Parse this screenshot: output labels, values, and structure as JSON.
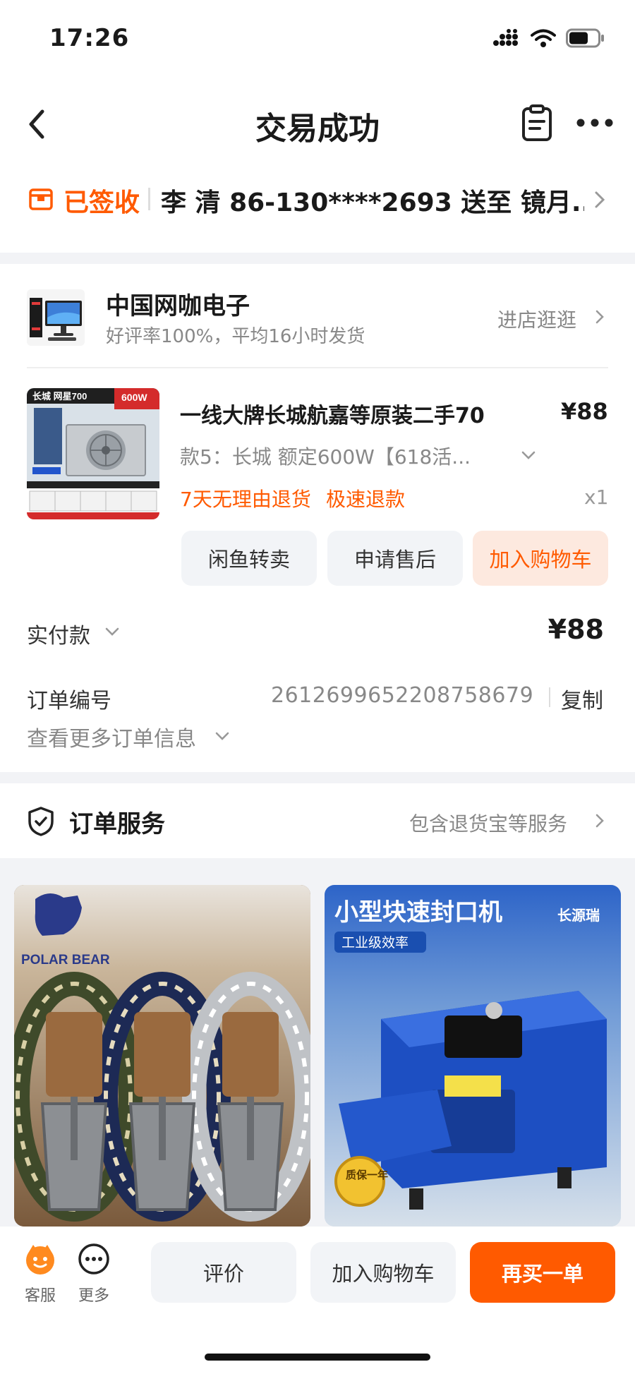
{
  "status_bar": {
    "time": "17:26"
  },
  "nav": {
    "title": "交易成功"
  },
  "delivery": {
    "status": "已签收",
    "recipient_line": "李 清 86-130****2693 送至 镜月..."
  },
  "shop": {
    "name": "中国网咖电子",
    "subtitle": "好评率100%，平均16小时发货",
    "link": "进店逛逛"
  },
  "product": {
    "title": "一线大牌长城航嘉等原装二手70",
    "price": "¥88",
    "spec": "款5：长城 额定600W【618活...",
    "tag_return": "7天无理由退货",
    "tag_refund": "极速退款",
    "quantity": "x1",
    "image_text": {
      "brand": "长城 网星700",
      "wattage": "600W"
    }
  },
  "actions": {
    "resell": "闲鱼转卖",
    "after_sale": "申请售后",
    "add_cart": "加入购物车"
  },
  "payment": {
    "label": "实付款",
    "amount": "¥88"
  },
  "order": {
    "label": "订单编号",
    "number": "2612699652208758679",
    "copy": "复制",
    "more_info": "查看更多订单信息"
  },
  "service": {
    "title": "订单服务",
    "link": "包含退货宝等服务"
  },
  "recommendations": [
    {
      "brand_text": "POLAR BEAR"
    },
    {
      "headline": "小型块速封口机",
      "badge": "工业级效率",
      "logo": "长源瑞",
      "seal": "质保一年"
    }
  ],
  "bottom_bar": {
    "service_label": "客服",
    "more_label": "更多",
    "review": "评价",
    "add_cart": "加入购物车",
    "buy_again": "再买一单"
  },
  "colors": {
    "accent": "#ff5a00",
    "muted_text": "#888888",
    "button_bg": "#f2f4f7"
  },
  "icons": [
    "back-icon",
    "document-icon",
    "more-dots-icon",
    "package-icon",
    "chevron-right-icon",
    "chevron-down-icon",
    "shield-check-icon",
    "customer-service-icon",
    "more-circle-icon"
  ]
}
